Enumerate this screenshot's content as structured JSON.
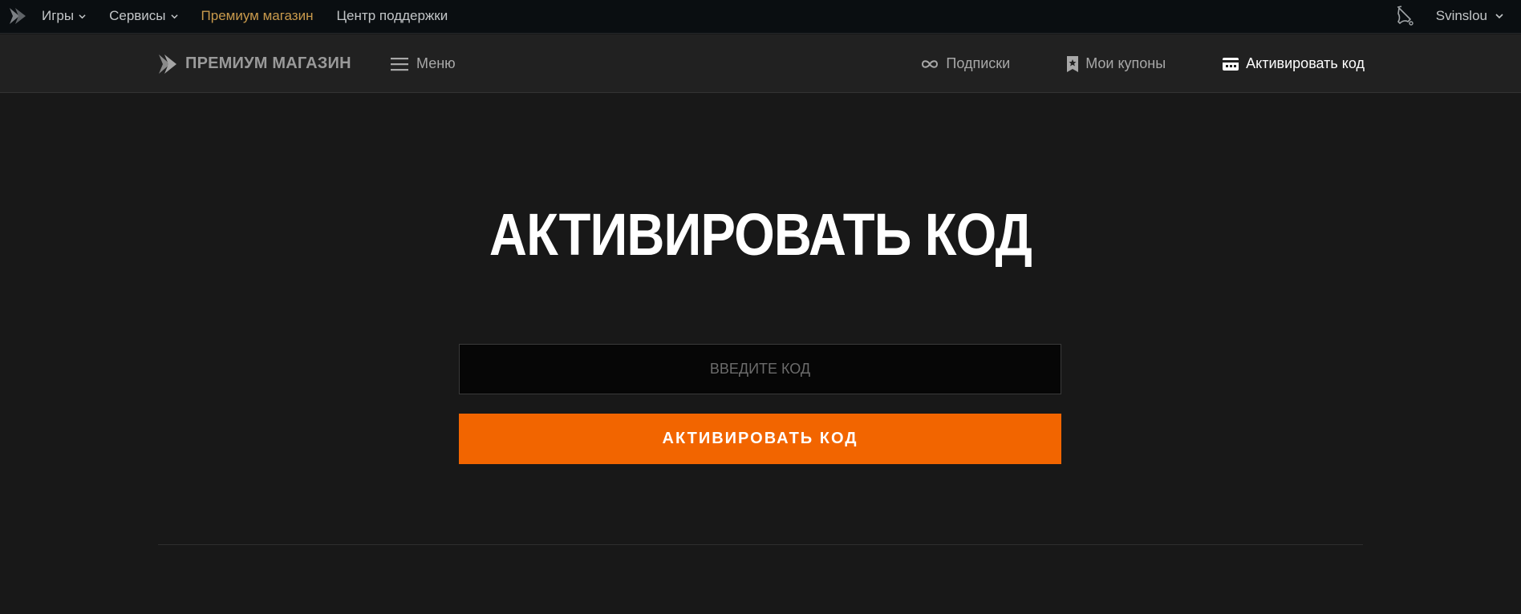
{
  "topbar": {
    "nav": [
      {
        "label": "Игры",
        "dropdown": true,
        "active": false
      },
      {
        "label": "Сервисы",
        "dropdown": true,
        "active": false
      },
      {
        "label": "Премиум магазин",
        "dropdown": false,
        "active": true
      },
      {
        "label": "Центр поддержки",
        "dropdown": false,
        "active": false
      }
    ],
    "username": "Svinslou",
    "icons": [
      "logo-icon",
      "bell-icon",
      "chevron-down-icon"
    ]
  },
  "shop": {
    "brand": "ПРЕМИУМ МАГАЗИН",
    "menu_label": "Меню",
    "nav": [
      {
        "label": "Подписки",
        "icon": "infinity-icon",
        "active": false
      },
      {
        "label": "Мои купоны",
        "icon": "coupon-icon",
        "active": false
      },
      {
        "label": "Активировать код",
        "icon": "code-card-icon",
        "active": true
      }
    ]
  },
  "main": {
    "title": "АКТИВИРОВАТЬ КОД",
    "input_placeholder": "ВВЕДИТЕ КОД",
    "input_value": "",
    "button_label": "АКТИВИРОВАТЬ КОД"
  },
  "colors": {
    "background": "#181818",
    "topbar": "#0a0e11",
    "shopbar": "#212121",
    "accent_orange": "#f26500",
    "active_gold": "#c99a4c"
  }
}
